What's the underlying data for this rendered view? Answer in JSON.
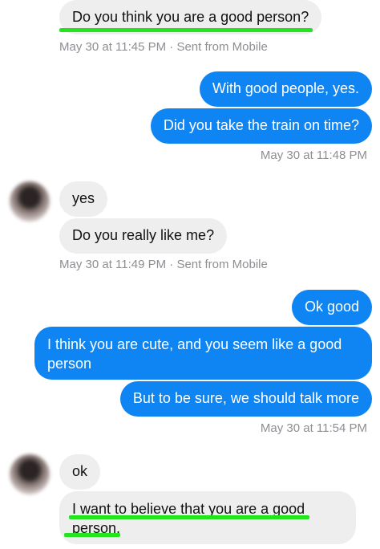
{
  "messages": [
    {
      "text": "Do you think you are a good person?",
      "direction": "incoming"
    },
    {
      "text": "With good people, yes.",
      "direction": "outgoing"
    },
    {
      "text": "Did you take the train on time?",
      "direction": "outgoing"
    },
    {
      "text": "yes",
      "direction": "incoming"
    },
    {
      "text": "Do you really like me?",
      "direction": "incoming"
    },
    {
      "text": "Ok good",
      "direction": "outgoing"
    },
    {
      "text": "I think you are cute, and you seem like a good person",
      "direction": "outgoing"
    },
    {
      "text": "But to be sure, we should talk more",
      "direction": "outgoing"
    },
    {
      "text": "ok",
      "direction": "incoming"
    },
    {
      "text": "I want to believe that you are a good person.",
      "direction": "incoming"
    }
  ],
  "timestamps": [
    "May 30 at 11:45 PM · Sent from Mobile",
    "May 30 at 11:48 PM",
    "May 30 at 11:49 PM · Sent from Mobile",
    "May 30 at 11:54 PM"
  ],
  "colors": {
    "outgoing_bubble": "#0f84f3",
    "incoming_bubble": "#eeeeef",
    "highlight": "#22e51e",
    "timestamp_text": "#8e8e93"
  },
  "icons": {
    "avatar": "blurred-profile-photo"
  }
}
